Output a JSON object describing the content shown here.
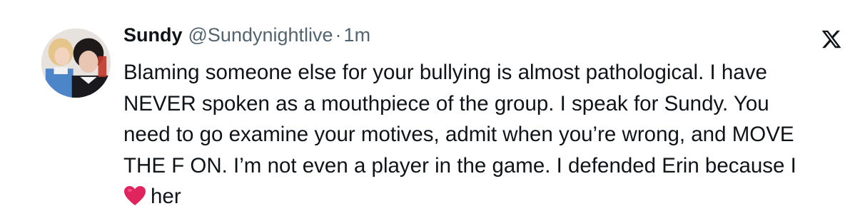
{
  "tweet": {
    "display_name": "Sundy",
    "handle": "@Sundynightlive",
    "separator": "·",
    "time": "1m",
    "lines": [
      "Blaming someone else for your bullying is almost pathological. I have",
      "NEVER spoken as a mouthpiece of the group. I speak for Sundy. You",
      "need to go examine your motives, admit when you’re wrong, and MOVE",
      "THE F ON. I’m not even a player in the game. I defended Erin because I"
    ],
    "last_line_emoji": "red-heart-icon",
    "last_line_text": "her"
  },
  "icons": {
    "platform": "x-logo-icon",
    "avatar": "profile-avatar"
  },
  "colors": {
    "text": "#0f1419",
    "secondary": "#536471",
    "heart": "#e0245e",
    "background": "#ffffff"
  }
}
